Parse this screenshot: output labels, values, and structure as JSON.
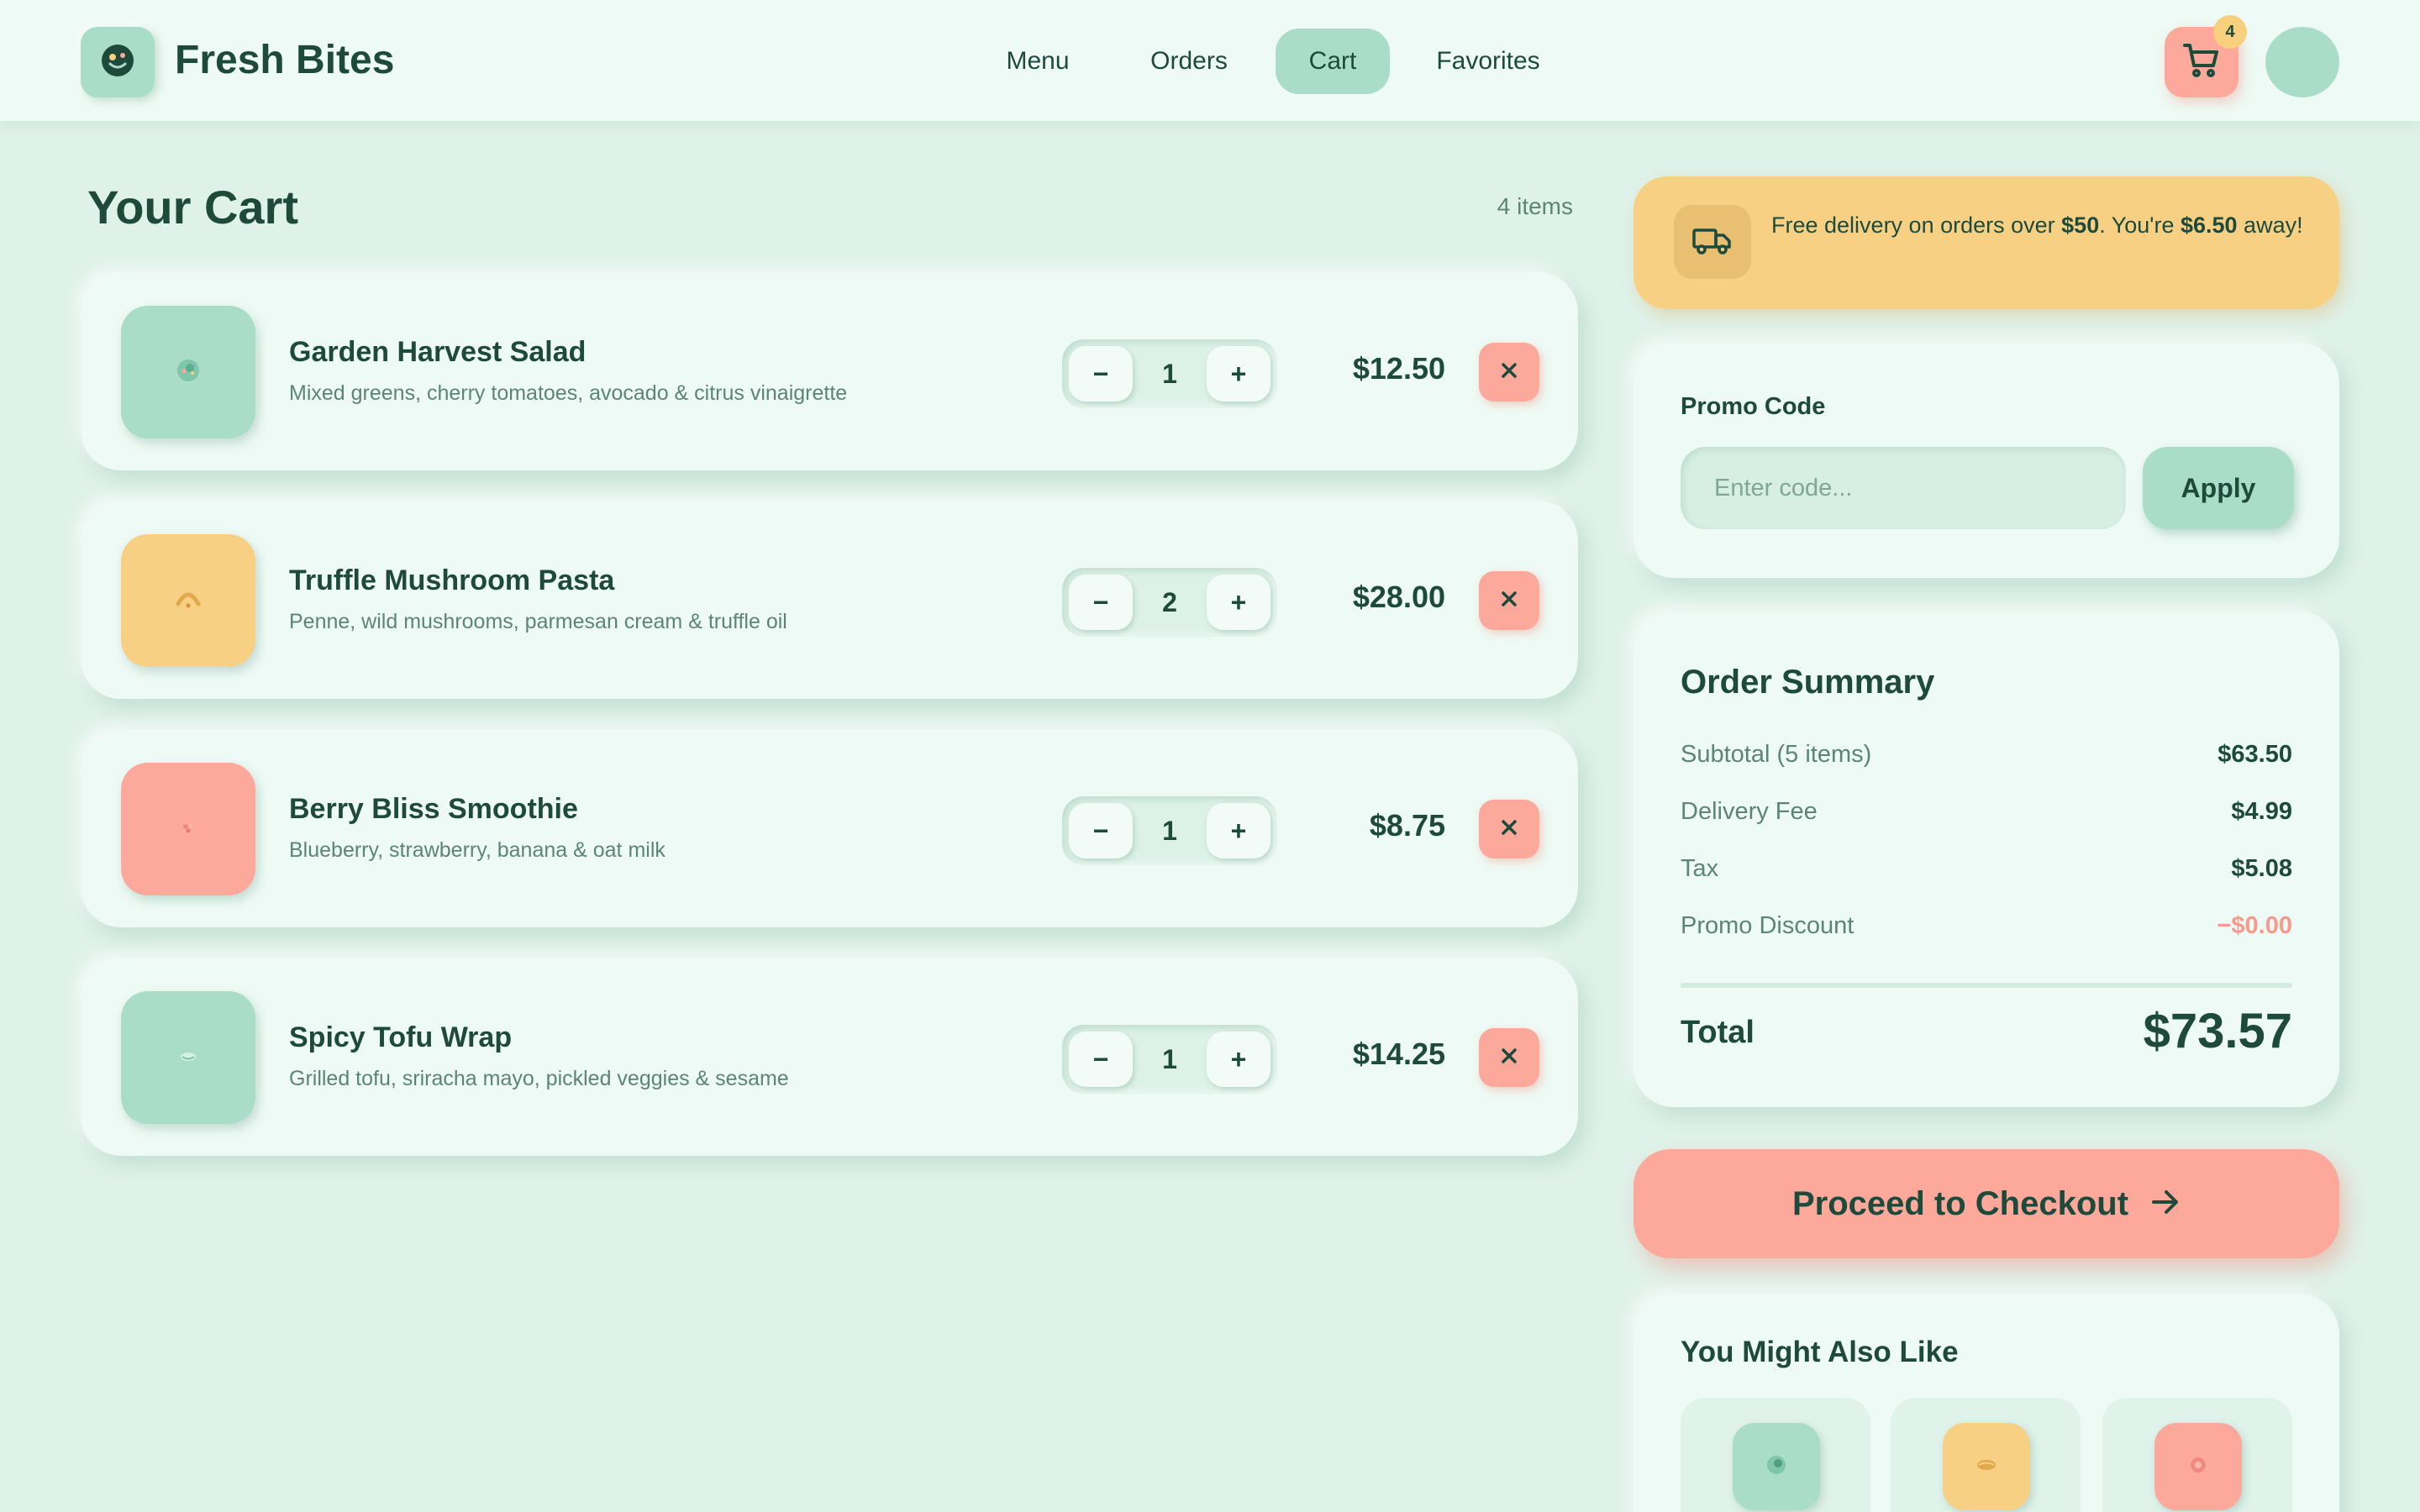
{
  "app": {
    "brand": "Fresh Bites",
    "colors": {
      "mint": "#a9dcc9",
      "peach": "#fca99c",
      "butter": "#f8d083",
      "background": "#dff2ea",
      "text": "#1e4a3c"
    }
  },
  "nav": {
    "items": [
      {
        "label": "Menu",
        "active": false
      },
      {
        "label": "Orders",
        "active": false
      },
      {
        "label": "Cart",
        "active": true
      },
      {
        "label": "Favorites",
        "active": false
      }
    ],
    "cart_badge": "4",
    "icons": {
      "logo": "smiley-icon",
      "cart": "cart-icon",
      "avatar": "avatar"
    }
  },
  "cart": {
    "title": "Your Cart",
    "count_label": "4 items",
    "items": [
      {
        "name": "Garden Harvest Salad",
        "description": "Mixed greens, cherry tomatoes, avocado & citrus vinaigrette",
        "qty": "1",
        "price": "$12.50",
        "color": "#a9dcc9",
        "icon": "salad-icon"
      },
      {
        "name": "Truffle Mushroom Pasta",
        "description": "Penne, wild mushrooms, parmesan cream & truffle oil",
        "qty": "2",
        "price": "$28.00",
        "color": "#f8d083",
        "icon": "pasta-icon"
      },
      {
        "name": "Berry Bliss Smoothie",
        "description": "Blueberry, strawberry, banana & oat milk",
        "qty": "1",
        "price": "$8.75",
        "color": "#fca99c",
        "icon": "smoothie-icon"
      },
      {
        "name": "Spicy Tofu Wrap",
        "description": "Grilled tofu, sriracha mayo, pickled veggies & sesame",
        "qty": "1",
        "price": "$14.25",
        "color": "#a9dcc9",
        "icon": "wrap-icon"
      }
    ],
    "stepper": {
      "minus": "−",
      "plus": "+"
    }
  },
  "delivery": {
    "prefix": "Free delivery on orders over ",
    "threshold": "$50",
    "middle": ". You're ",
    "remaining": "$6.50",
    "suffix": " away!",
    "icon": "truck-icon"
  },
  "promo": {
    "label": "Promo Code",
    "placeholder": "Enter code...",
    "value": "",
    "apply_label": "Apply"
  },
  "summary": {
    "title": "Order Summary",
    "rows": [
      {
        "label": "Subtotal (5 items)",
        "value": "$63.50"
      },
      {
        "label": "Delivery Fee",
        "value": "$4.99"
      },
      {
        "label": "Tax",
        "value": "$5.08"
      },
      {
        "label": "Promo Discount",
        "value": "−$0.00"
      }
    ],
    "total_label": "Total",
    "total_value": "$73.57"
  },
  "checkout": {
    "label": "Proceed to Checkout",
    "icon": "arrow-right-icon"
  },
  "suggestions": {
    "title": "You Might Also Like",
    "items": [
      {
        "color": "#a9dcc9",
        "icon": "bowl-icon"
      },
      {
        "color": "#f8d083",
        "icon": "bun-icon"
      },
      {
        "color": "#fca99c",
        "icon": "berry-icon"
      }
    ]
  }
}
